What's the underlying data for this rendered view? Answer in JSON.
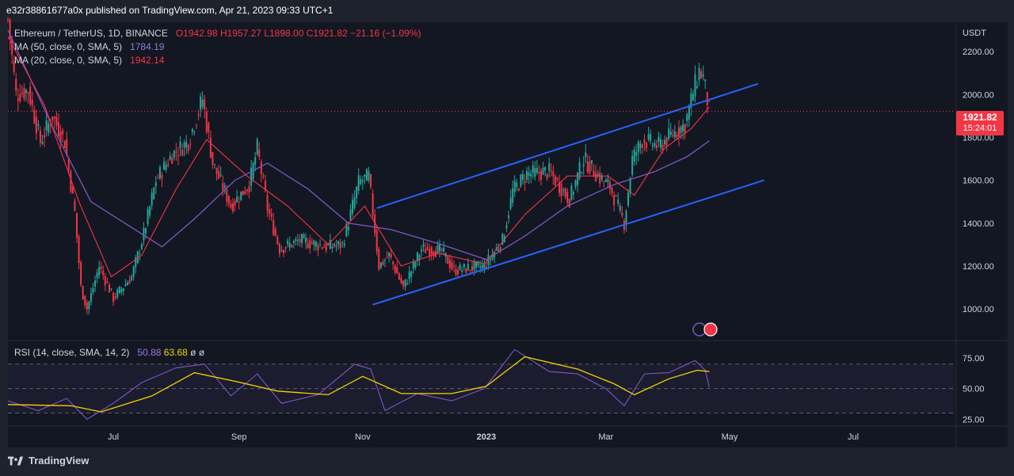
{
  "header": {
    "published": "e32r38861677a0x published on TradingView.com, Apr 21, 2023 09:33 UTC+1"
  },
  "legend": {
    "symbol": "Ethereum / TetherUS, 1D, BINANCE",
    "open": "O1942.98",
    "high": "H1957.27",
    "low": "L1898.00",
    "close": "C1921.82",
    "change": "−21.16 (−1.09%)",
    "ma50_label": "MA (50, close, 0, SMA, 5)",
    "ma50_value": "1784.19",
    "ma20_label": "MA (20, close, 0, SMA, 5)",
    "ma20_value": "1942.14"
  },
  "rsi_legend": {
    "label": "RSI (14, close, SMA, 14, 2)",
    "value1": "50.88",
    "value2": "63.68",
    "extra": "ø ø"
  },
  "price_tag": {
    "price": "1921.82",
    "countdown": "15:24:01"
  },
  "footer": {
    "brand": "TradingView"
  },
  "colors": {
    "bull": "#26a69a",
    "bear": "#f23645",
    "ma50": "#7e57c2",
    "ma20": "#f23645",
    "channel": "#2962ff",
    "rsi": "#7e57c2",
    "rsi_ma": "#f5d300"
  },
  "chart_data": {
    "type": "candlestick",
    "currency_label": "USDT",
    "y_ticks": [
      1000,
      1200,
      1400,
      1600,
      1800,
      2000,
      2200
    ],
    "y_tick_labels": [
      "1000.00",
      "1200.00",
      "1400.00",
      "1600.00",
      "1800.00",
      "2000.00",
      "2200.00"
    ],
    "ylim": [
      860,
      2330
    ],
    "x_tick_labels": [
      "Jul",
      "Sep",
      "Nov",
      "2023",
      "Mar",
      "May",
      "Jul"
    ],
    "rsi_ticks": [
      25,
      50,
      75
    ],
    "rsi_tick_labels": [
      "25.00",
      "50.00",
      "75.00"
    ],
    "rsi_ylim": [
      20,
      88
    ],
    "price_path": [
      [
        "2022-05-10",
        2350
      ],
      [
        "2022-05-14",
        2000
      ],
      [
        "2022-05-20",
        2020
      ],
      [
        "2022-05-26",
        1780
      ],
      [
        "2022-06-01",
        1900
      ],
      [
        "2022-06-07",
        1780
      ],
      [
        "2022-06-12",
        1450
      ],
      [
        "2022-06-15",
        1100
      ],
      [
        "2022-06-18",
        1000
      ],
      [
        "2022-06-24",
        1200
      ],
      [
        "2022-07-01",
        1050
      ],
      [
        "2022-07-10",
        1150
      ],
      [
        "2022-07-16",
        1350
      ],
      [
        "2022-07-22",
        1600
      ],
      [
        "2022-07-30",
        1720
      ],
      [
        "2022-08-07",
        1780
      ],
      [
        "2022-08-14",
        1980
      ],
      [
        "2022-08-19",
        1680
      ],
      [
        "2022-08-28",
        1480
      ],
      [
        "2022-09-06",
        1580
      ],
      [
        "2022-09-10",
        1750
      ],
      [
        "2022-09-15",
        1470
      ],
      [
        "2022-09-21",
        1280
      ],
      [
        "2022-10-01",
        1320
      ],
      [
        "2022-10-14",
        1290
      ],
      [
        "2022-10-22",
        1300
      ],
      [
        "2022-10-30",
        1590
      ],
      [
        "2022-11-04",
        1620
      ],
      [
        "2022-11-09",
        1200
      ],
      [
        "2022-11-14",
        1250
      ],
      [
        "2022-11-21",
        1100
      ],
      [
        "2022-11-30",
        1280
      ],
      [
        "2022-12-10",
        1270
      ],
      [
        "2022-12-16",
        1180
      ],
      [
        "2022-12-31",
        1200
      ],
      [
        "2023-01-09",
        1320
      ],
      [
        "2023-01-14",
        1550
      ],
      [
        "2023-01-21",
        1630
      ],
      [
        "2023-02-01",
        1640
      ],
      [
        "2023-02-11",
        1510
      ],
      [
        "2023-02-18",
        1700
      ],
      [
        "2023-02-26",
        1610
      ],
      [
        "2023-03-03",
        1570
      ],
      [
        "2023-03-10",
        1400
      ],
      [
        "2023-03-14",
        1700
      ],
      [
        "2023-03-19",
        1790
      ],
      [
        "2023-03-27",
        1760
      ],
      [
        "2023-04-02",
        1810
      ],
      [
        "2023-04-09",
        1860
      ],
      [
        "2023-04-13",
        2010
      ],
      [
        "2023-04-16",
        2110
      ],
      [
        "2023-04-18",
        2080
      ],
      [
        "2023-04-21",
        1922
      ]
    ],
    "ma50_path": [
      [
        "2022-05-10",
        2300
      ],
      [
        "2022-06-01",
        1850
      ],
      [
        "2022-06-20",
        1500
      ],
      [
        "2022-07-10",
        1380
      ],
      [
        "2022-07-25",
        1290
      ],
      [
        "2022-08-10",
        1420
      ],
      [
        "2022-08-30",
        1600
      ],
      [
        "2022-09-15",
        1680
      ],
      [
        "2022-10-05",
        1560
      ],
      [
        "2022-10-25",
        1400
      ],
      [
        "2022-11-15",
        1370
      ],
      [
        "2022-12-10",
        1300
      ],
      [
        "2023-01-01",
        1230
      ],
      [
        "2023-01-20",
        1340
      ],
      [
        "2023-02-10",
        1480
      ],
      [
        "2023-03-05",
        1580
      ],
      [
        "2023-03-25",
        1640
      ],
      [
        "2023-04-10",
        1710
      ],
      [
        "2023-04-21",
        1784
      ]
    ],
    "ma20_path": [
      [
        "2022-05-10",
        2270
      ],
      [
        "2022-05-28",
        1950
      ],
      [
        "2022-06-14",
        1500
      ],
      [
        "2022-06-30",
        1150
      ],
      [
        "2022-07-15",
        1250
      ],
      [
        "2022-08-01",
        1560
      ],
      [
        "2022-08-16",
        1790
      ],
      [
        "2022-09-05",
        1620
      ],
      [
        "2022-09-25",
        1480
      ],
      [
        "2022-10-15",
        1300
      ],
      [
        "2022-11-02",
        1480
      ],
      [
        "2022-11-20",
        1200
      ],
      [
        "2022-12-08",
        1260
      ],
      [
        "2022-12-31",
        1210
      ],
      [
        "2023-01-20",
        1440
      ],
      [
        "2023-02-10",
        1620
      ],
      [
        "2023-03-02",
        1620
      ],
      [
        "2023-03-15",
        1530
      ],
      [
        "2023-03-30",
        1750
      ],
      [
        "2023-04-12",
        1840
      ],
      [
        "2023-04-21",
        1942
      ]
    ],
    "channel_upper": [
      [
        "2022-11-08",
        1470
      ],
      [
        "2023-05-15",
        2050
      ]
    ],
    "channel_lower": [
      [
        "2022-11-06",
        1020
      ],
      [
        "2023-05-18",
        1600
      ]
    ],
    "current_price": 1921.82,
    "rsi_path": [
      [
        "2022-05-10",
        40
      ],
      [
        "2022-05-25",
        32
      ],
      [
        "2022-06-08",
        42
      ],
      [
        "2022-06-18",
        25
      ],
      [
        "2022-07-01",
        38
      ],
      [
        "2022-07-15",
        55
      ],
      [
        "2022-08-01",
        67
      ],
      [
        "2022-08-15",
        70
      ],
      [
        "2022-08-28",
        44
      ],
      [
        "2022-09-10",
        62
      ],
      [
        "2022-09-22",
        38
      ],
      [
        "2022-10-10",
        45
      ],
      [
        "2022-10-28",
        70
      ],
      [
        "2022-11-05",
        66
      ],
      [
        "2022-11-12",
        32
      ],
      [
        "2022-11-28",
        46
      ],
      [
        "2022-12-15",
        40
      ],
      [
        "2022-12-31",
        50
      ],
      [
        "2023-01-15",
        82
      ],
      [
        "2023-02-01",
        64
      ],
      [
        "2023-02-15",
        62
      ],
      [
        "2023-03-01",
        50
      ],
      [
        "2023-03-10",
        36
      ],
      [
        "2023-03-20",
        62
      ],
      [
        "2023-04-01",
        63
      ],
      [
        "2023-04-14",
        73
      ],
      [
        "2023-04-19",
        65
      ],
      [
        "2023-04-21",
        51
      ]
    ],
    "rsi_ma_path": [
      [
        "2022-05-10",
        37
      ],
      [
        "2022-06-10",
        36
      ],
      [
        "2022-06-25",
        31
      ],
      [
        "2022-07-20",
        44
      ],
      [
        "2022-08-10",
        63
      ],
      [
        "2022-08-30",
        56
      ],
      [
        "2022-09-20",
        48
      ],
      [
        "2022-10-15",
        45
      ],
      [
        "2022-11-01",
        60
      ],
      [
        "2022-11-20",
        46
      ],
      [
        "2022-12-15",
        46
      ],
      [
        "2023-01-01",
        52
      ],
      [
        "2023-01-20",
        76
      ],
      [
        "2023-02-15",
        66
      ],
      [
        "2023-03-05",
        54
      ],
      [
        "2023-03-15",
        45
      ],
      [
        "2023-04-01",
        58
      ],
      [
        "2023-04-15",
        65
      ],
      [
        "2023-04-21",
        64
      ]
    ]
  }
}
